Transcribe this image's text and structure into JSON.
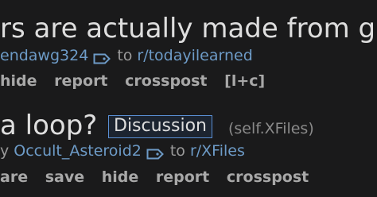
{
  "post1": {
    "title": "rs are actually made from gre",
    "author": "endawg324",
    "to_text": "to",
    "subreddit": "r/todayilearned",
    "actions": [
      "hide",
      "report",
      "crosspost",
      "[l+c]"
    ]
  },
  "post2": {
    "title": "a loop?",
    "flair": "Discussion",
    "domain": "(self.XFiles)",
    "by_text": "y",
    "author": "Occult_Asteroid2",
    "to_text": "to",
    "subreddit": "r/XFiles",
    "actions": [
      "are",
      "save",
      "hide",
      "report",
      "crosspost"
    ]
  },
  "colors": {
    "background": "#1a1a1b",
    "title_text": "#dedede",
    "link": "#6d9bc7",
    "meta_text": "#9a9a9a",
    "flair_border": "#5a8fd4"
  },
  "icons": {
    "tag": "tag-icon"
  }
}
